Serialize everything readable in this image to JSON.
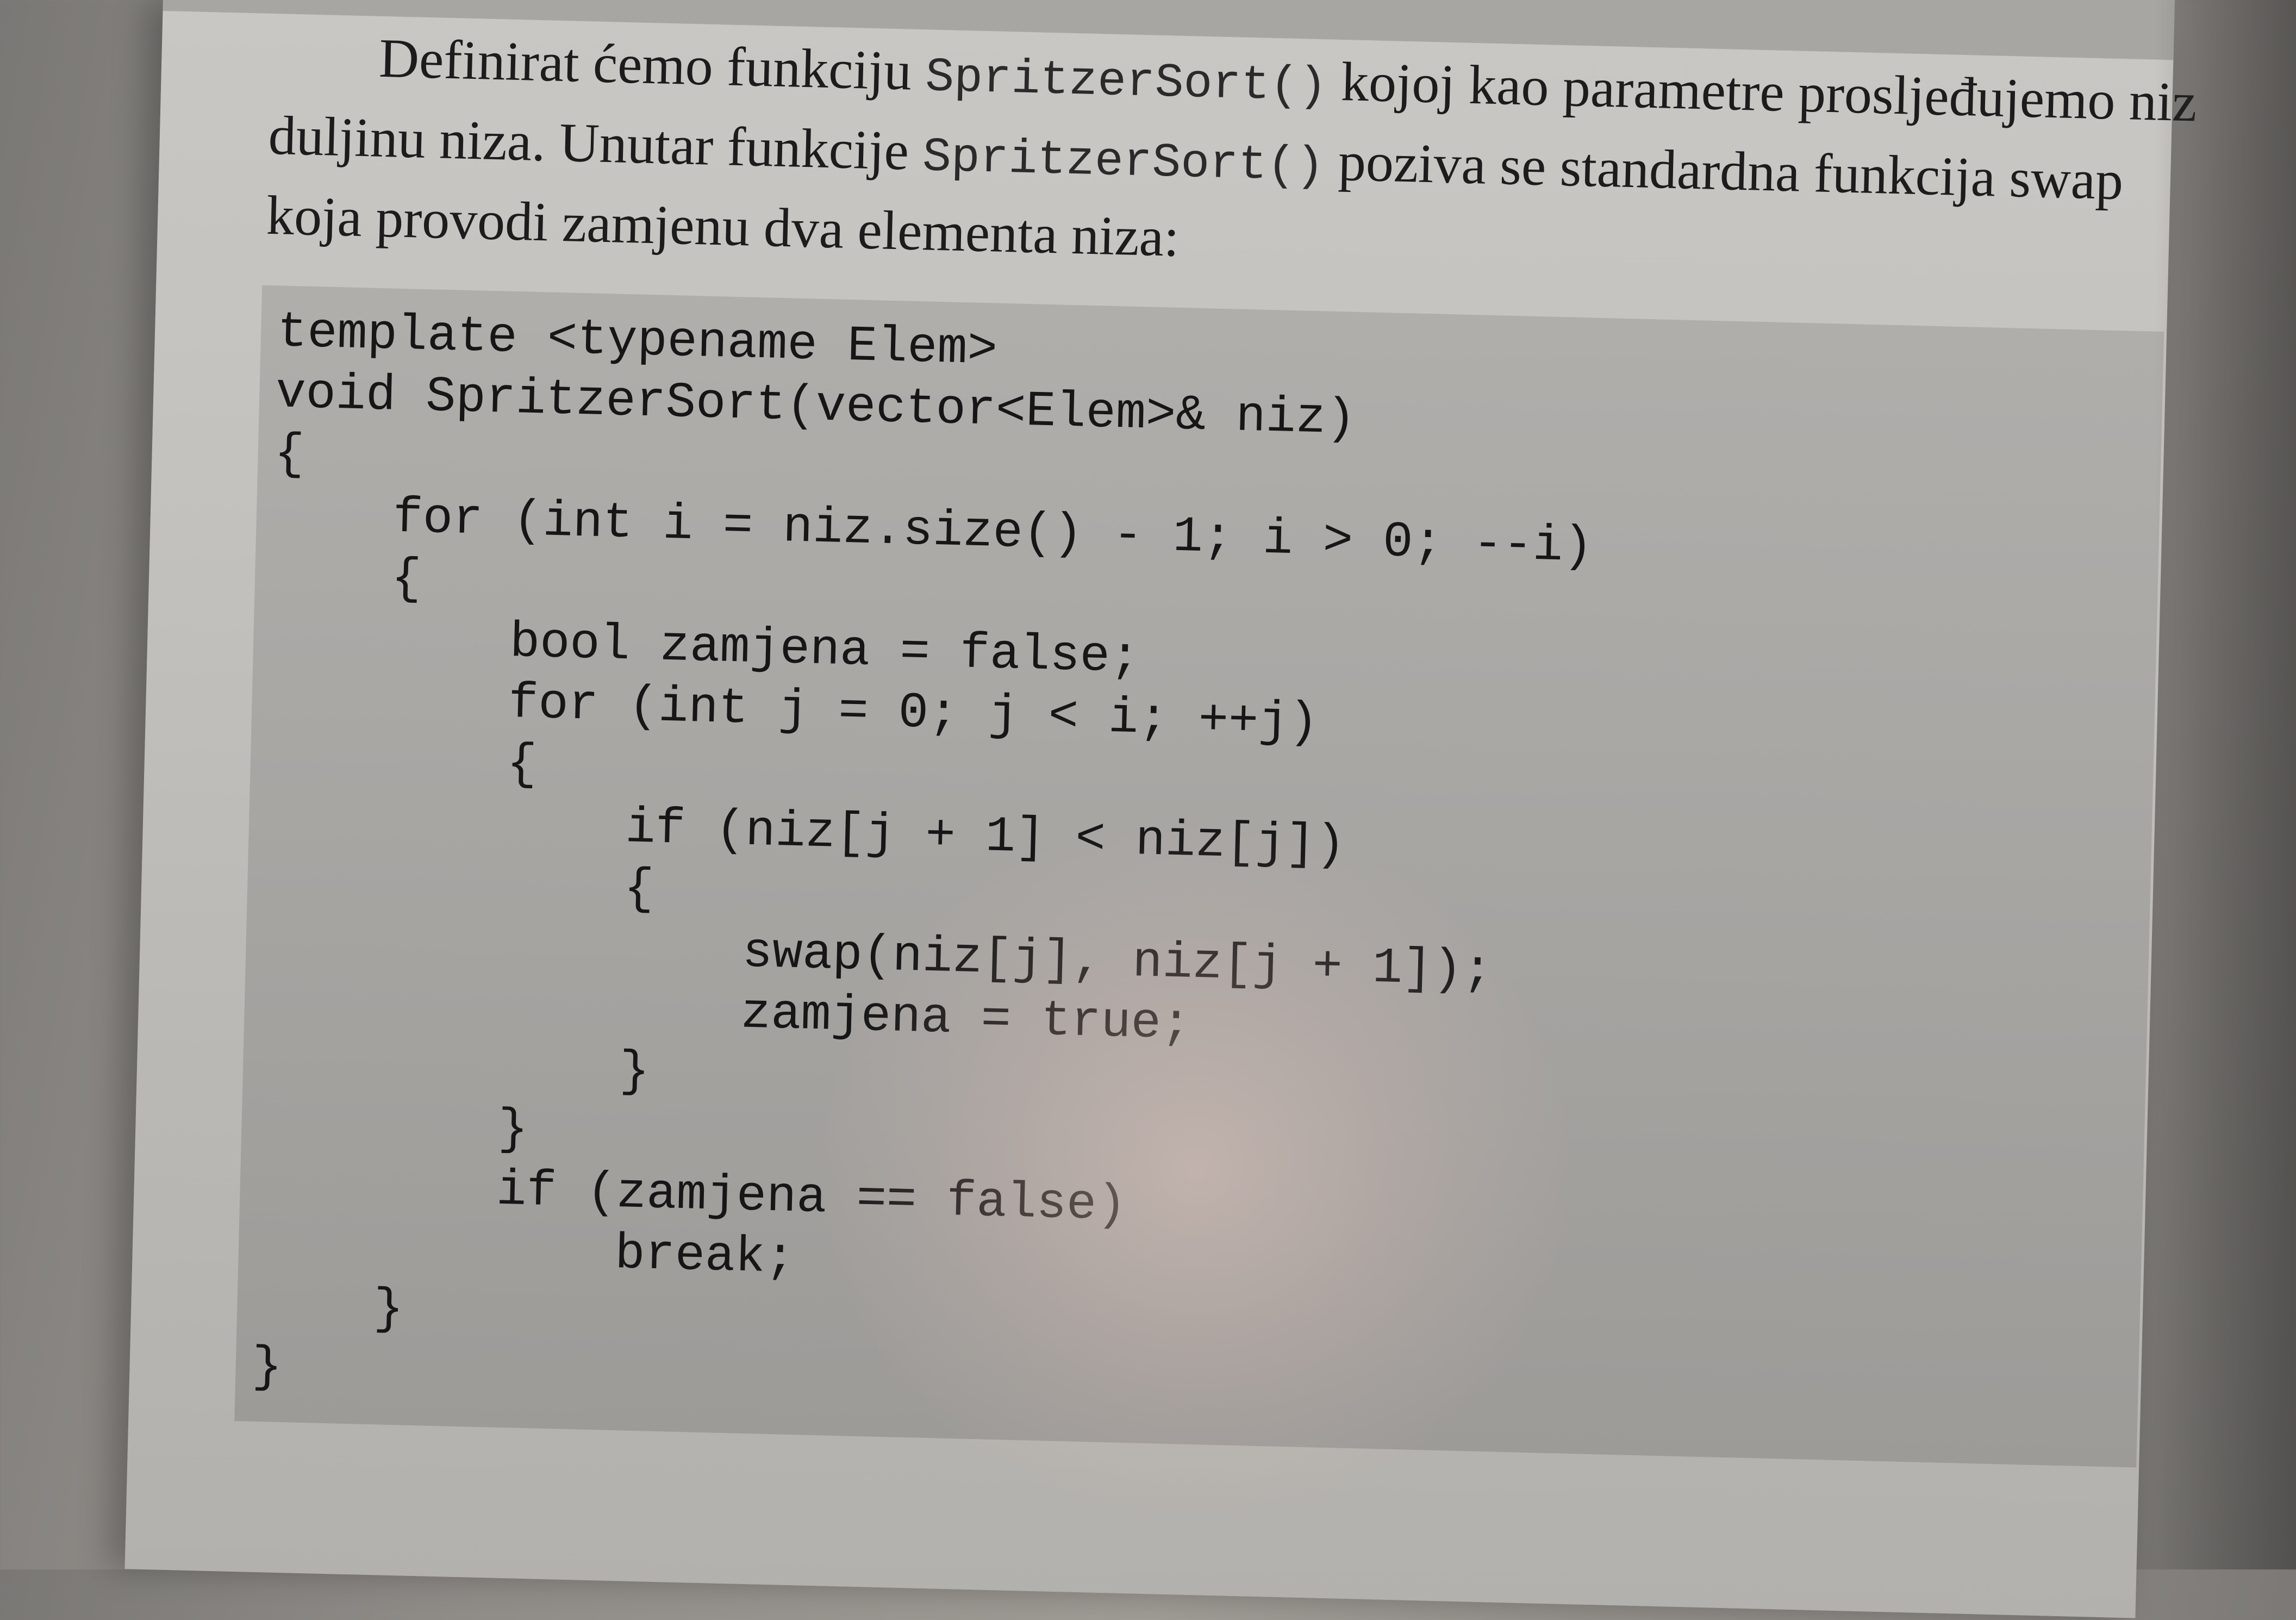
{
  "paragraph": {
    "line1_text_a": "Definirat ćemo funkciju ",
    "line1_code": "SpritzerSort()",
    "line1_text_b": " kojoj kao parametre prosljeđujemo niz",
    "line2_text_a": "duljinu niza. Unutar funkcije ",
    "line2_code": "SpritzerSort()",
    "line2_text_b": " poziva se standardna funkcija swap",
    "line3_text": "koja provodi zamjenu dva elementa niza:"
  },
  "code": {
    "lines": [
      "template <typename Elem>",
      "void SpritzerSort(vector<Elem>& niz)",
      "{",
      "    for (int i = niz.size() - 1; i > 0; --i)",
      "    {",
      "        bool zamjena = false;",
      "        for (int j = 0; j < i; ++j)",
      "        {",
      "            if (niz[j + 1] < niz[j])",
      "            {",
      "                swap(niz[j], niz[j + 1]);",
      "                zamjena = true;",
      "            }",
      "        }",
      "        if (zamjena == false)",
      "            break;",
      "    }",
      "}"
    ]
  }
}
